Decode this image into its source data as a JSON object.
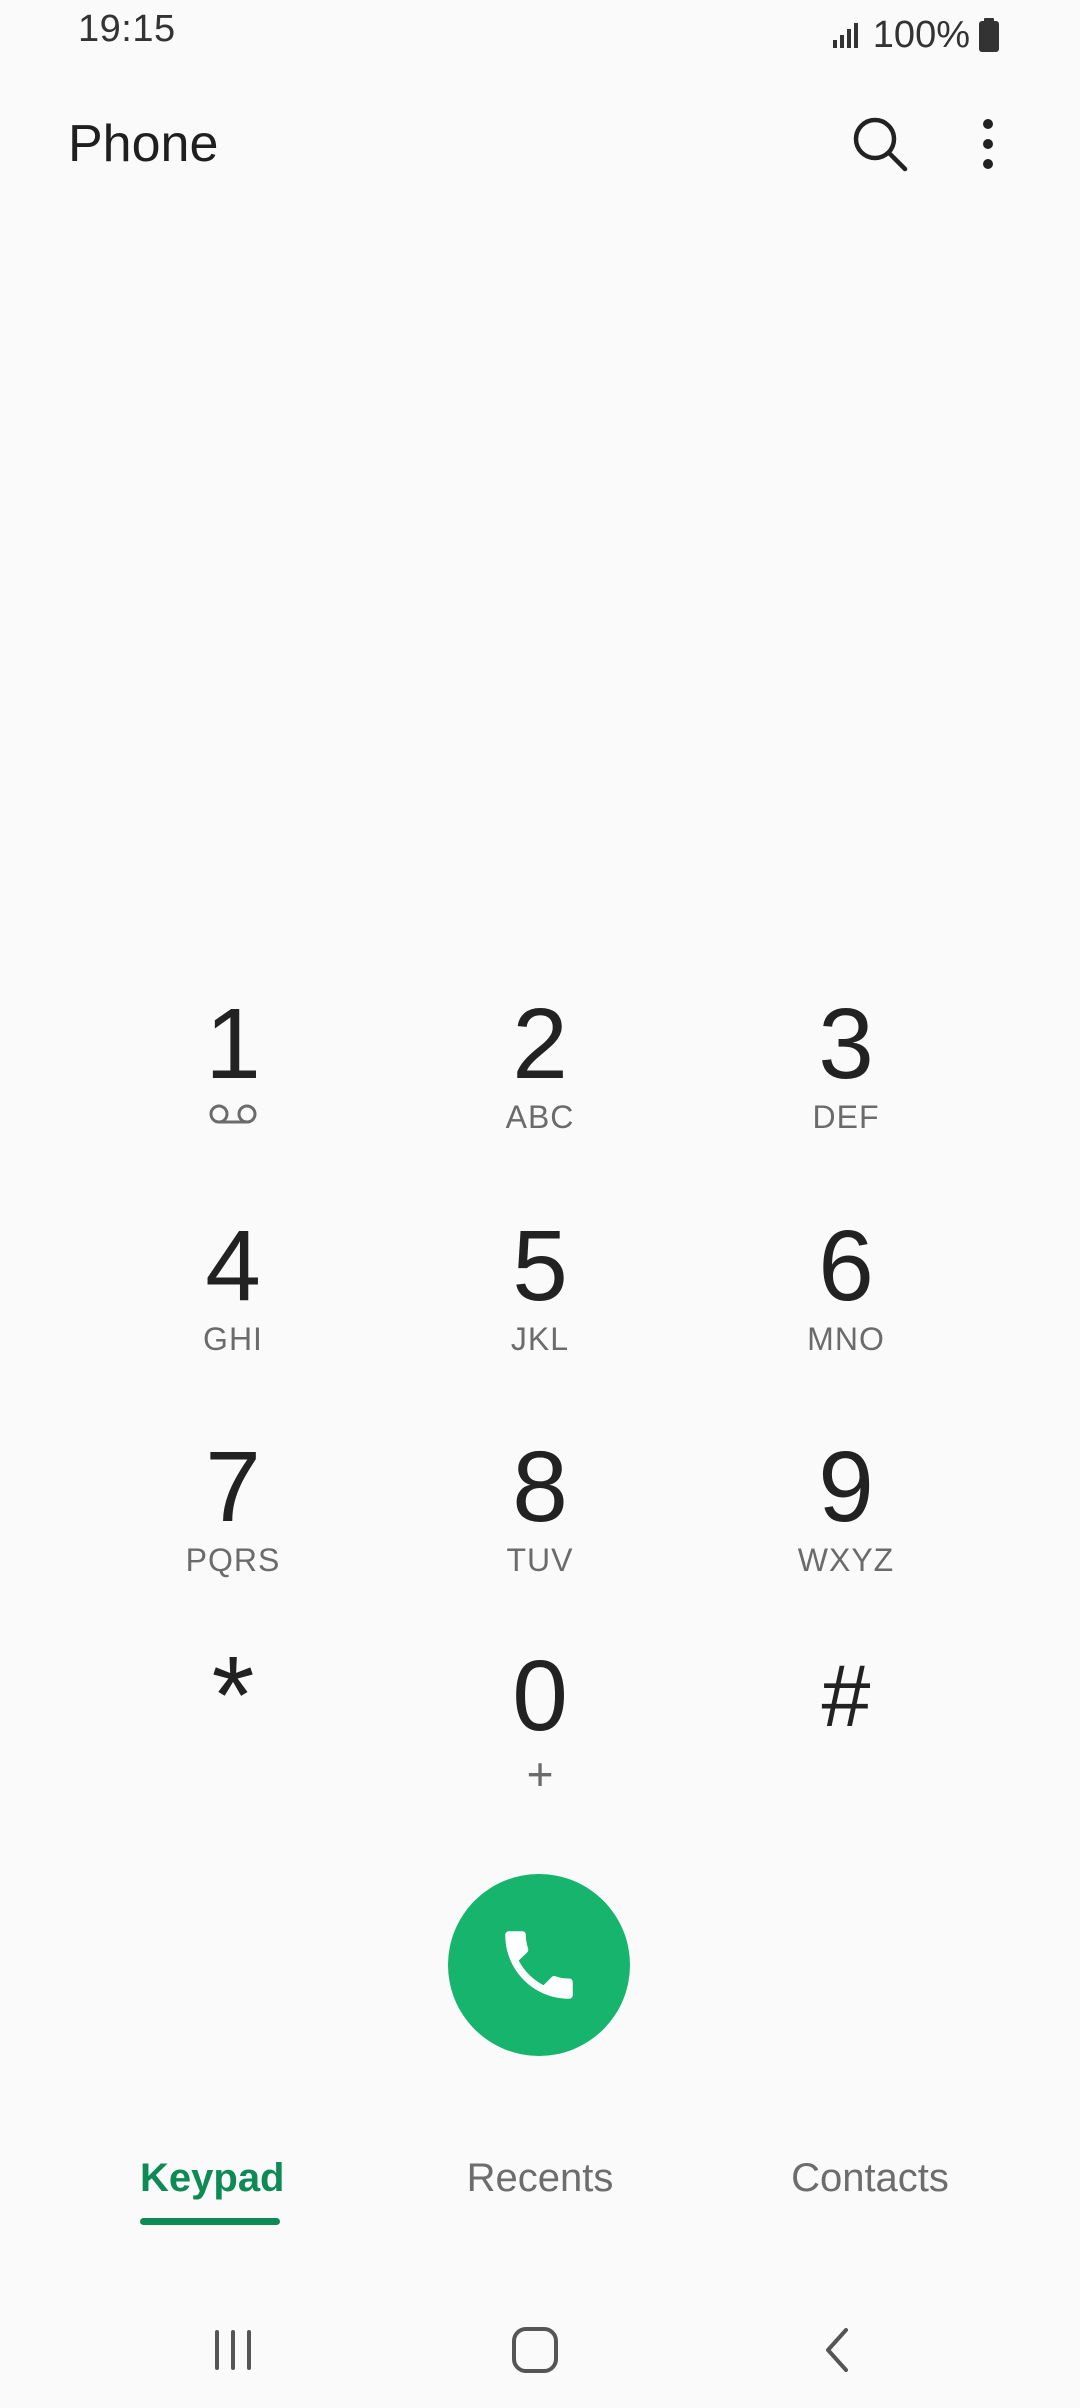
{
  "status_bar": {
    "time": "19:15",
    "battery": "100%",
    "icons": [
      "signal-icon",
      "battery-icon"
    ]
  },
  "app_bar": {
    "title": "Phone",
    "icons": [
      "search-icon",
      "more-options-icon"
    ]
  },
  "keypad": {
    "keys": [
      {
        "digit": "1",
        "letters": "",
        "icon": "voicemail-icon"
      },
      {
        "digit": "2",
        "letters": "ABC"
      },
      {
        "digit": "3",
        "letters": "DEF"
      },
      {
        "digit": "4",
        "letters": "GHI"
      },
      {
        "digit": "5",
        "letters": "JKL"
      },
      {
        "digit": "6",
        "letters": "MNO"
      },
      {
        "digit": "7",
        "letters": "PQRS"
      },
      {
        "digit": "8",
        "letters": "TUV"
      },
      {
        "digit": "9",
        "letters": "WXYZ"
      },
      {
        "digit": "*",
        "letters": ""
      },
      {
        "digit": "0",
        "letters": "+"
      },
      {
        "digit": "#",
        "letters": ""
      }
    ]
  },
  "call_button": {
    "icon": "phone-call-icon",
    "color": "#16b46c"
  },
  "tabs": {
    "items": [
      {
        "label": "Keypad",
        "active": true
      },
      {
        "label": "Recents",
        "active": false
      },
      {
        "label": "Contacts",
        "active": false
      }
    ],
    "active_color": "#0e8a57"
  },
  "nav_bar": {
    "icons": [
      "recent-apps-icon",
      "home-icon",
      "back-icon"
    ]
  }
}
